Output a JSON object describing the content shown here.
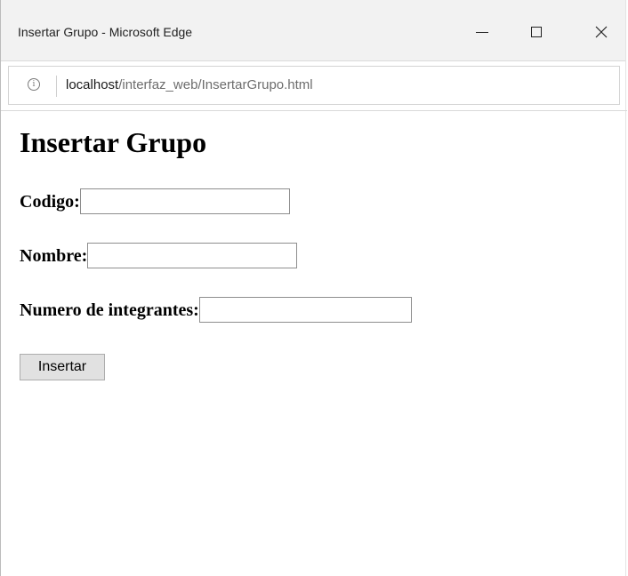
{
  "window": {
    "title": "Insertar Grupo - Microsoft Edge",
    "controls": {
      "minimize": "minimize-icon",
      "maximize": "maximize-icon",
      "close": "close-icon"
    }
  },
  "addressbar": {
    "info_icon": "info-icon",
    "host": "localhost",
    "path": "/interfaz_web/InsertarGrupo.html"
  },
  "page": {
    "heading": "Insertar Grupo",
    "form": {
      "codigo_label": "Codigo:",
      "codigo_value": "",
      "nombre_label": "Nombre:",
      "nombre_value": "",
      "numero_label": "Numero de integrantes:",
      "numero_value": "",
      "submit_label": "Insertar"
    }
  }
}
